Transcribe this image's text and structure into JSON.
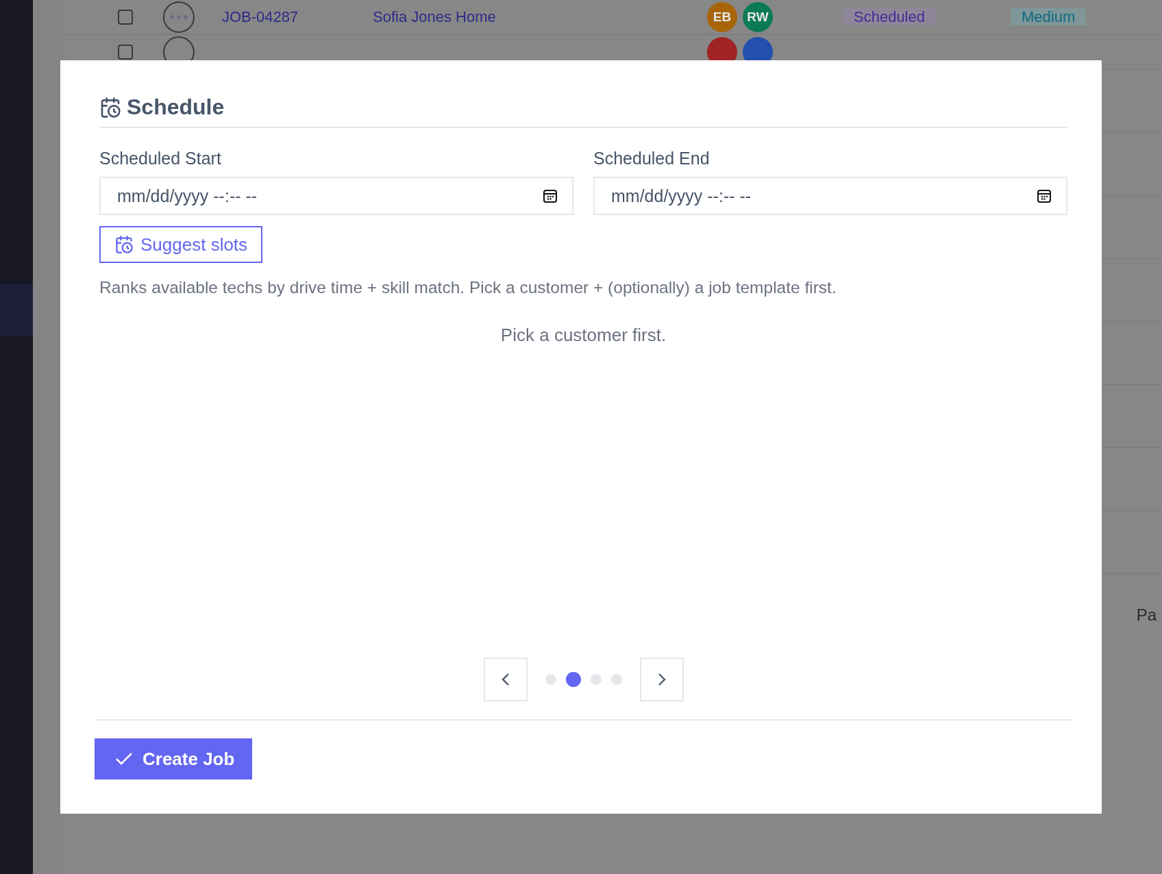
{
  "background_table": {
    "rows": [
      {
        "checked": false,
        "job": "JOB-04287",
        "customer": "Sofia Jones Home",
        "assignees": [
          {
            "initials": "EB",
            "color": "#a86408"
          },
          {
            "initials": "RW",
            "color": "#0b7a55"
          }
        ],
        "status": "Scheduled",
        "priority": "Medium"
      },
      {
        "checked": false,
        "assignees": [
          {
            "color": "#a02424"
          },
          {
            "color": "#234fae"
          }
        ]
      }
    ]
  },
  "pagination_text": "Pa",
  "modal": {
    "section_title": "Schedule",
    "fields": [
      {
        "label": "Scheduled Start",
        "placeholder": "mm/dd/yyyy --:-- --"
      },
      {
        "label": "Scheduled End",
        "placeholder": "mm/dd/yyyy --:-- --"
      }
    ],
    "suggest_button": "Suggest slots",
    "hint": "Ranks available techs by drive time + skill match. Pick a customer + (optionally) a job template first.",
    "empty_message": "Pick a customer first.",
    "pager": {
      "dots": [
        {
          "selected": false
        },
        {
          "selected": true
        },
        {
          "selected": false
        },
        {
          "selected": false
        }
      ]
    },
    "submit_button": "Create Job"
  }
}
